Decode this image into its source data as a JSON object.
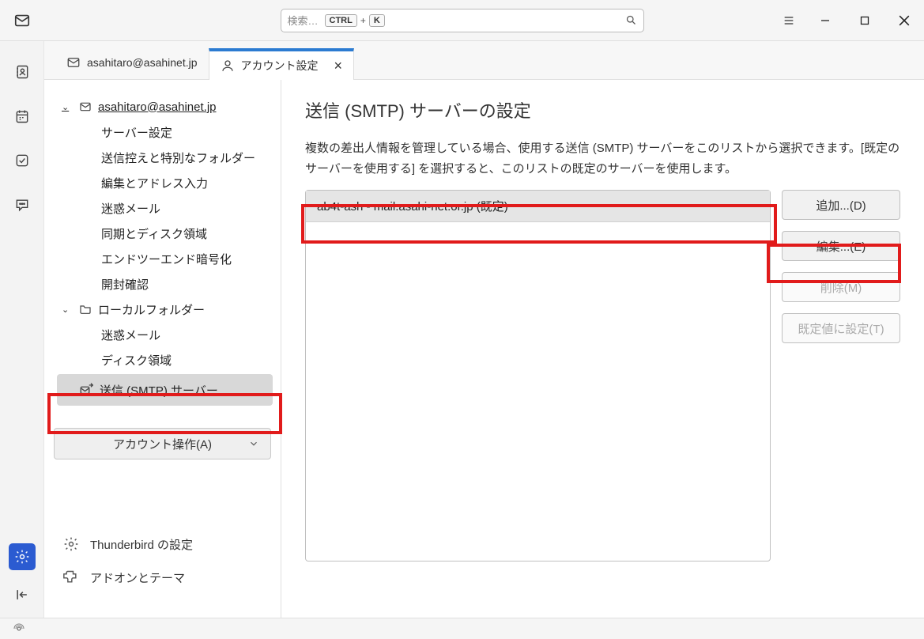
{
  "search": {
    "placeholder": "検索…",
    "kbd1": "CTRL",
    "plus": "+",
    "kbd2": "K"
  },
  "tabs": {
    "account": {
      "label": "asahitaro@asahinet.jp"
    },
    "settings": {
      "label": "アカウント設定"
    }
  },
  "tree": {
    "account_root": "asahitaro@asahinet.jp",
    "account_children": [
      "サーバー設定",
      "送信控えと特別なフォルダー",
      "編集とアドレス入力",
      "迷惑メール",
      "同期とディスク領域",
      "エンドツーエンド暗号化",
      "開封確認"
    ],
    "local_root": "ローカルフォルダー",
    "local_children": [
      "迷惑メール",
      "ディスク領域"
    ],
    "smtp": "送信 (SMTP) サーバー"
  },
  "account_ops": "アカウント操作(A)",
  "footer": {
    "settings": "Thunderbird の設定",
    "addons": "アドオンとテーマ"
  },
  "pane": {
    "title": "送信 (SMTP) サーバーの設定",
    "desc": "複数の差出人情報を管理している場合、使用する送信 (SMTP) サーバーをこのリストから選択できます。[既定のサーバーを使用する] を選択すると、このリストの既定のサーバーを使用します。",
    "server_item": "ab4t-ash - mail.asahi-net.or.jp (既定)",
    "buttons": {
      "add": "追加...(D)",
      "edit": "編集...(E)",
      "delete": "削除(M)",
      "default": "既定値に設定(T)"
    }
  },
  "status": {
    "sync": "(○)"
  }
}
